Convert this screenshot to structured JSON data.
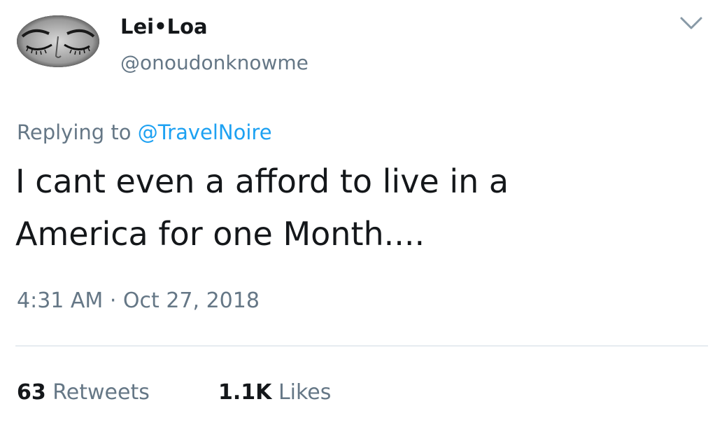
{
  "author": {
    "display_name": "Lei•Loa",
    "handle": "@onoudonknowme",
    "avatar_icon": "avatar-closed-eyes"
  },
  "reply": {
    "prefix": "Replying to ",
    "mention": "@TravelNoire"
  },
  "tweet": {
    "text": "I cant even a afford to live in a America for one Month...."
  },
  "timestamp": "4:31 AM · Oct 27, 2018",
  "stats": {
    "retweets_count": "63",
    "retweets_label": "Retweets",
    "likes_count": "1.1K",
    "likes_label": "Likes"
  },
  "menu": {
    "icon": "chevron-down-icon"
  },
  "colors": {
    "text": "#14171a",
    "secondary": "#657786",
    "link": "#1da1f2",
    "divider": "#e6ecf0"
  }
}
